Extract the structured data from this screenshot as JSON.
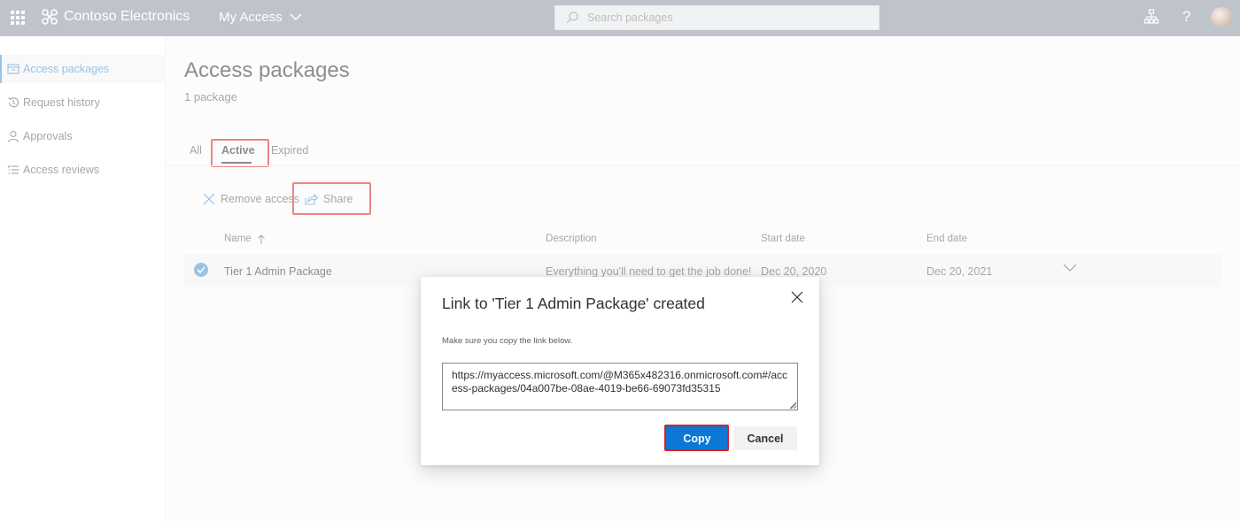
{
  "topbar": {
    "org_name": "Contoso Electronics",
    "app_name": "My Access",
    "search_placeholder": "Search packages"
  },
  "sidebar": {
    "items": [
      {
        "label": "Access packages",
        "icon": "package-icon",
        "active": true
      },
      {
        "label": "Request history",
        "icon": "history-icon",
        "active": false
      },
      {
        "label": "Approvals",
        "icon": "person-icon",
        "active": false
      },
      {
        "label": "Access reviews",
        "icon": "checklist-icon",
        "active": false
      }
    ]
  },
  "main": {
    "title": "Access packages",
    "subtitle": "1 package",
    "tabs": [
      {
        "label": "All"
      },
      {
        "label": "Active",
        "selected": true
      },
      {
        "label": "Expired"
      }
    ],
    "commands": {
      "remove_label": "Remove access",
      "share_label": "Share"
    },
    "table": {
      "columns": [
        "Name",
        "Description",
        "Start date",
        "End date"
      ],
      "rows": [
        {
          "name": "Tier 1 Admin Package",
          "description": "Everything you'll need to get the job done!",
          "start_date": "Dec 20, 2020",
          "end_date": "Dec 20, 2021",
          "selected": true
        }
      ]
    }
  },
  "dialog": {
    "title": "Link to 'Tier 1 Admin Package' created",
    "hint": "Make sure you copy the link below.",
    "link": "https://myaccess.microsoft.com/@M365x482316.onmicrosoft.com#/access-packages/04a007be-08ae-4019-be66-69073fd35315",
    "copy_label": "Copy",
    "cancel_label": "Cancel"
  },
  "colors": {
    "topbar": "#8a94a0",
    "accent": "#4a90c8",
    "primary_button": "#0a78d4",
    "highlight": "#e02020"
  }
}
